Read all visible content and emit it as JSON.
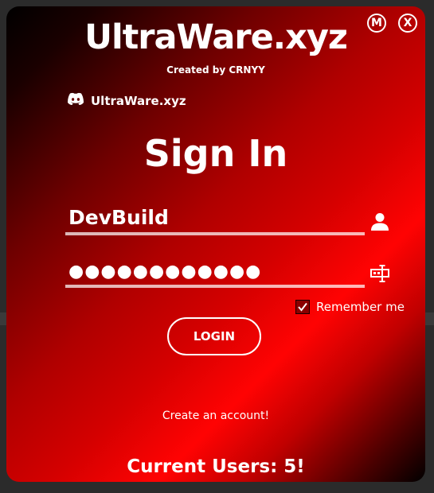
{
  "app": {
    "title": "UltraWare.xyz",
    "subtitle": "Created by CRNYY"
  },
  "window_controls": {
    "minimize_label": "M",
    "close_label": "X"
  },
  "discord": {
    "icon": "discord-icon",
    "label": "UltraWare.xyz"
  },
  "form": {
    "heading": "Sign In",
    "username": {
      "value": "DevBuild",
      "icon": "user-icon"
    },
    "password": {
      "value": "●●●●●●●●●●●●",
      "icon": "password-field-icon"
    },
    "remember": {
      "label": "Remember me",
      "checked": true
    },
    "login_label": "LOGIN",
    "create_account_label": "Create an account!"
  },
  "footer": {
    "current_users": "Current Users: 5!"
  },
  "colors": {
    "accent": "#ff0303",
    "dark": "#000000",
    "text": "#ffffff"
  }
}
